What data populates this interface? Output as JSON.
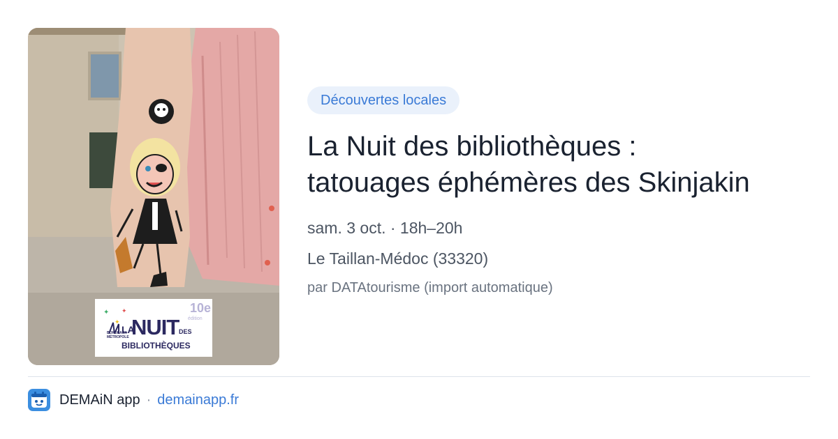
{
  "card": {
    "image": {
      "description_icon": "event-photo",
      "logo": {
        "la": "LA",
        "nuit": "NUIT",
        "des": "DES",
        "bibliotheques": "BIBLIOTHÈQUES",
        "edition_number": "10e",
        "edition_word": "édition",
        "bordeaux_metropole": "BORDEAUX MÉTROPOLE"
      }
    },
    "category": "Découvertes locales",
    "title_line1": "La Nuit des bibliothèques :",
    "title_line2": "tatouages éphémères des Skinjakin",
    "date_time": "sam. 3 oct. · 18h–20h",
    "location": "Le Taillan-Médoc (33320)",
    "source": "par DATAtourisme (import automatique)"
  },
  "footer": {
    "app_name": "DEMAiN app",
    "separator": "·",
    "domain": "demainapp.fr",
    "app_icon": "demain-app-icon"
  },
  "colors": {
    "accent": "#3a7ad6",
    "pill_bg": "#eaf1fb",
    "title": "#1a2230",
    "meta": "#4c5562"
  }
}
